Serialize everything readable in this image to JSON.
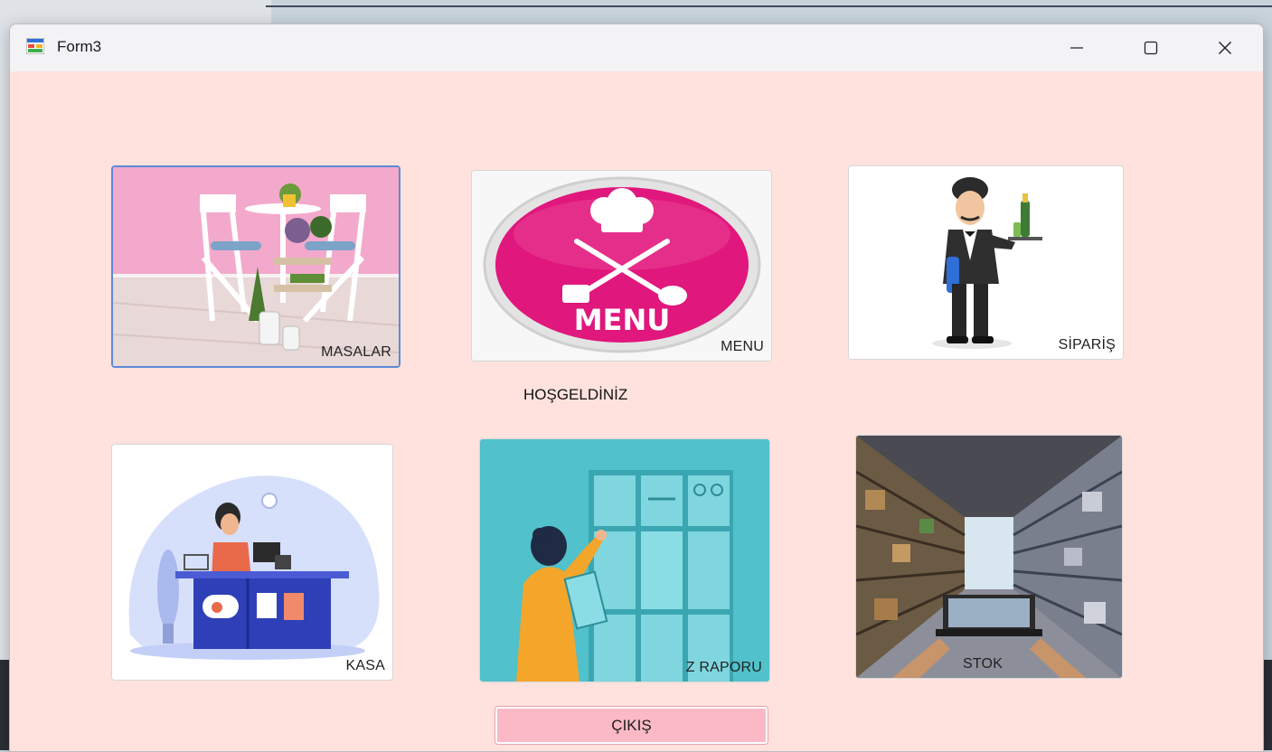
{
  "window": {
    "title": "Form3"
  },
  "titlebar_icons": {
    "app": "form-app-icon",
    "minimize": "minimize-icon",
    "maximize": "maximize-icon",
    "close": "close-icon"
  },
  "tiles": {
    "masalar": {
      "label": "MASALAR",
      "image": "tables-image"
    },
    "menu": {
      "label": "MENU",
      "image": "menu-badge-image",
      "badge_text": "MENU"
    },
    "siparis": {
      "label": "SİPARİŞ",
      "image": "waiter-image"
    },
    "kasa": {
      "label": "KASA",
      "image": "cashier-image"
    },
    "zraporu": {
      "label": "Z RAPORU",
      "image": "report-image"
    },
    "stok": {
      "label": "STOK",
      "image": "warehouse-image"
    }
  },
  "welcome": "HOŞGELDİNİZ",
  "exit": {
    "label": "ÇIKIŞ"
  },
  "colors": {
    "form_background": "#ffe2dd",
    "exit_button": "#fbb9c6",
    "selection_border": "#5b8bd6",
    "menu_badge": "#e0177c"
  }
}
